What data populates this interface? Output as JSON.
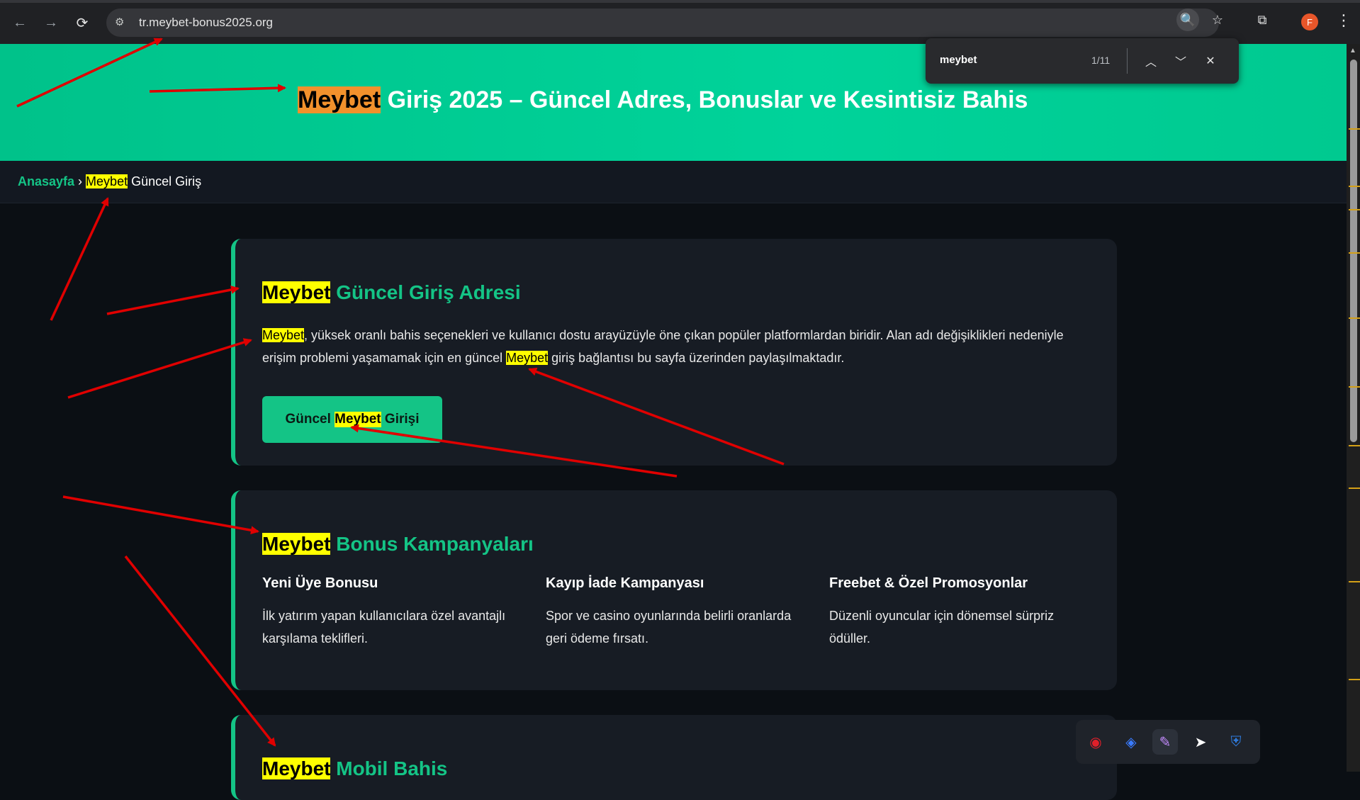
{
  "browser": {
    "url": "tr.meybet-bonus2025.org",
    "back_icon": "←",
    "forward_icon": "→",
    "reload_icon": "⟳",
    "avatar_letter": "F"
  },
  "find": {
    "query": "meybet",
    "count": "1/11"
  },
  "hero": {
    "title_highlight": "Meybet",
    "title_rest": " Giriş 2025 – Güncel Adres, Bonuslar ve Kesintisiz Bahis"
  },
  "breadcrumb": {
    "home": "Anasayfa",
    "separator": " › ",
    "current_highlight": "Meybet",
    "current_rest": " Güncel Giriş"
  },
  "section1": {
    "title_highlight": "Meybet",
    "title_rest": " Güncel Giriş Adresi",
    "para_hl1": "Meybet",
    "para_part1": ", yüksek oranlı bahis seçenekleri ve kullanıcı dostu arayüzüyle öne çıkan popüler platformlardan biridir. Alan adı değişiklikleri nedeniyle erişim problemi yaşamamak için en güncel ",
    "para_hl2": "Meybet",
    "para_part2": " giriş bağlantısı bu sayfa üzerinden paylaşılmaktadır.",
    "button_pre": "Güncel ",
    "button_hl": "Meybet",
    "button_post": " Girişi"
  },
  "section2": {
    "title_highlight": "Meybet",
    "title_rest": " Bonus Kampanyaları",
    "cols": [
      {
        "title": "Yeni Üye Bonusu",
        "text": "İlk yatırım yapan kullanıcılara özel avantajlı karşılama teklifleri."
      },
      {
        "title": "Kayıp İade Kampanyası",
        "text": "Spor ve casino oyunlarında belirli oranlarda geri ödeme fırsatı."
      },
      {
        "title": "Freebet & Özel Promosyonlar",
        "text": "Düzenli oyuncular için dönemsel sürpriz ödüller."
      }
    ]
  },
  "section3": {
    "title_highlight": "Meybet",
    "title_rest": " Mobil Bahis"
  },
  "colors": {
    "accent": "#14c486",
    "hero_bg": "#00d39a",
    "highlight_active": "#f2912c",
    "highlight": "#ffff00",
    "annotation_arrow": "#e00000"
  }
}
